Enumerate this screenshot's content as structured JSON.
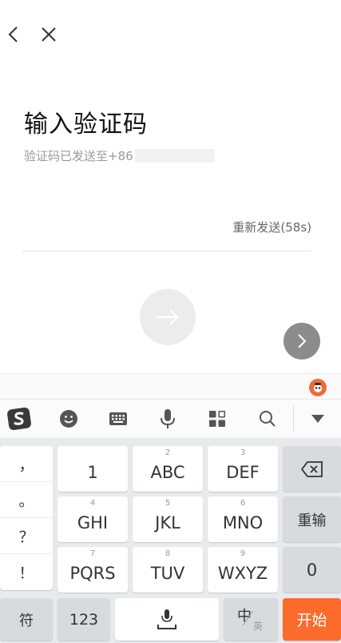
{
  "header": {
    "back_icon": "chevron-left-icon",
    "close_icon": "close-icon"
  },
  "page": {
    "title": "输入验证码",
    "subtitle_prefix": "验证码已发送至+86",
    "resend": "重新发送(58s)"
  },
  "ime": {
    "badge_icon": "sogou-skin-icon",
    "toolbar": [
      "sogou-logo-icon",
      "emoji-icon",
      "keyboard-icon",
      "microphone-icon",
      "apps-grid-icon",
      "search-icon",
      "collapse-keyboard-icon"
    ]
  },
  "keyboard": {
    "symbols": [
      "，",
      "。",
      "？",
      "！"
    ],
    "keys": [
      {
        "sub": "",
        "main": "1"
      },
      {
        "sub": "2",
        "main": "ABC"
      },
      {
        "sub": "3",
        "main": "DEF"
      },
      {
        "sub": "4",
        "main": "GHI"
      },
      {
        "sub": "5",
        "main": "JKL"
      },
      {
        "sub": "6",
        "main": "MNO"
      },
      {
        "sub": "7",
        "main": "PQRS"
      },
      {
        "sub": "8",
        "main": "TUV"
      },
      {
        "sub": "9",
        "main": "WXYZ"
      }
    ],
    "reenter": "重输",
    "zero": "0",
    "symbol_key": "符",
    "num_key": "123",
    "zh_label": "中",
    "en_label": "英",
    "go_key": "开始"
  },
  "colors": {
    "accent": "#fa6b2c",
    "keyboard_bg": "#e9eaed"
  }
}
